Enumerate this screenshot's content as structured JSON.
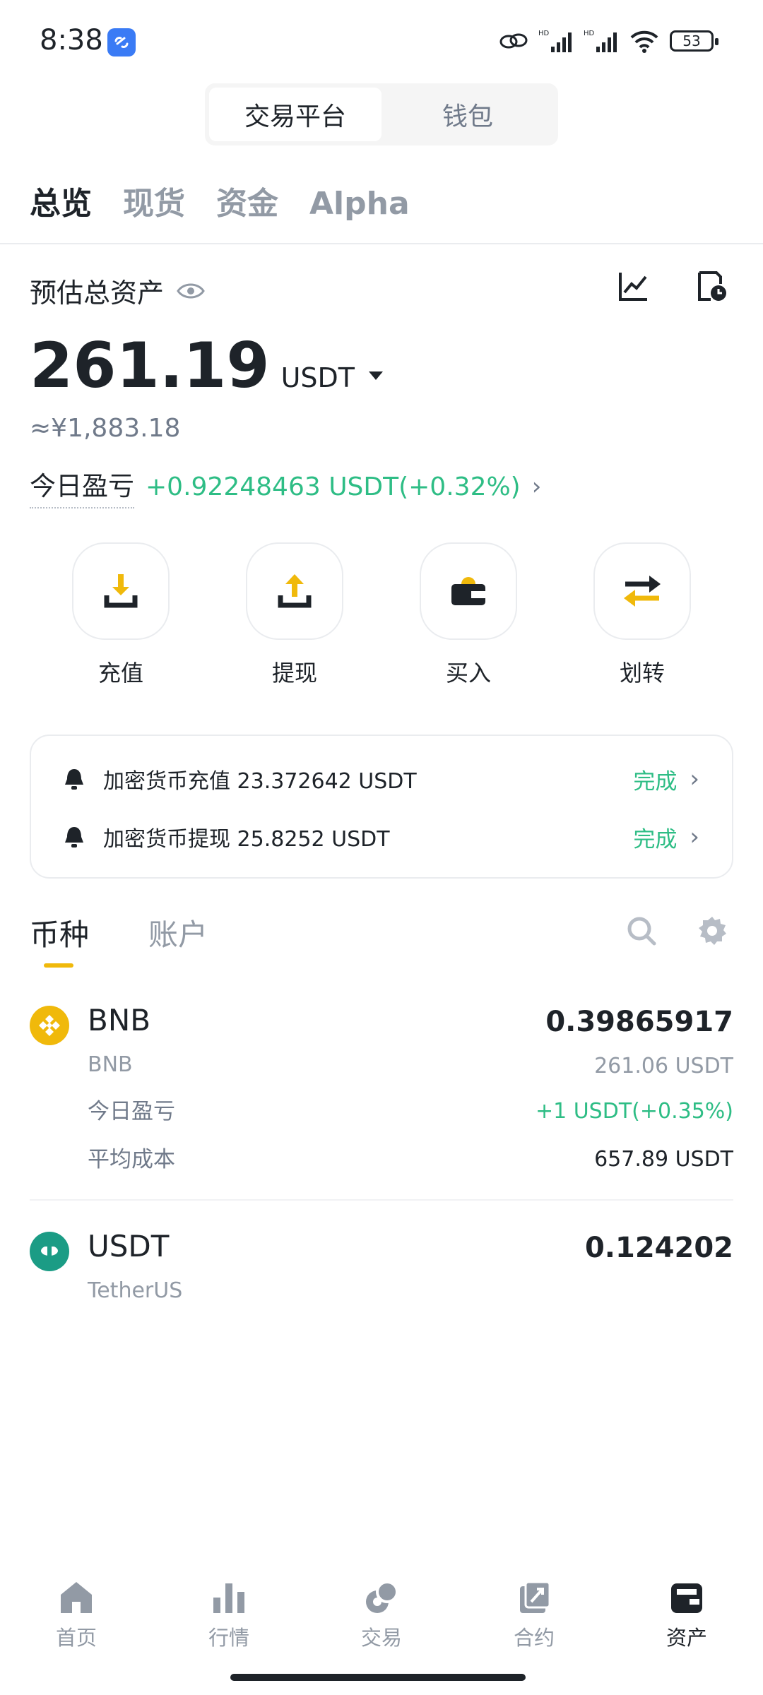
{
  "status_bar": {
    "time": "8:38",
    "battery": "53"
  },
  "segmented": {
    "items": [
      "交易平台",
      "钱包"
    ]
  },
  "top_tabs": [
    "总览",
    "现货",
    "资金",
    "Alpha"
  ],
  "overview": {
    "label": "预估总资产",
    "balance": "261.19",
    "unit": "USDT",
    "fiat": "≈¥1,883.18",
    "pnl_label": "今日盈亏",
    "pnl_value": "+0.92248463 USDT(+0.32%)"
  },
  "actions": [
    {
      "label": "充值",
      "icon": "deposit-icon"
    },
    {
      "label": "提现",
      "icon": "withdraw-icon"
    },
    {
      "label": "买入",
      "icon": "buy-icon"
    },
    {
      "label": "划转",
      "icon": "transfer-icon"
    }
  ],
  "notices": [
    {
      "text": "加密货币充值 23.372642 USDT",
      "status": "完成"
    },
    {
      "text": "加密货币提现 25.8252 USDT",
      "status": "完成"
    }
  ],
  "section_tabs": [
    "币种",
    "账户"
  ],
  "assets": [
    {
      "symbol": "BNB",
      "name": "BNB",
      "amount": "0.39865917",
      "value": "261.06 USDT",
      "pnl_label": "今日盈亏",
      "pnl_value": "+1 USDT(+0.35%)",
      "cost_label": "平均成本",
      "cost_value": "657.89 USDT",
      "logo_color": "#f0b90b"
    },
    {
      "symbol": "USDT",
      "name": "TetherUS",
      "amount": "0.124202",
      "logo_color": "#1b9c85"
    }
  ],
  "bottom_nav": [
    {
      "label": "首页",
      "icon": "home-icon"
    },
    {
      "label": "行情",
      "icon": "markets-icon"
    },
    {
      "label": "交易",
      "icon": "trade-icon"
    },
    {
      "label": "合约",
      "icon": "futures-icon"
    },
    {
      "label": "资产",
      "icon": "assets-icon"
    }
  ],
  "colors": {
    "accent": "#f0b90b",
    "positive": "#2ebd85",
    "text": "#1e2329",
    "muted": "#929aa5"
  }
}
